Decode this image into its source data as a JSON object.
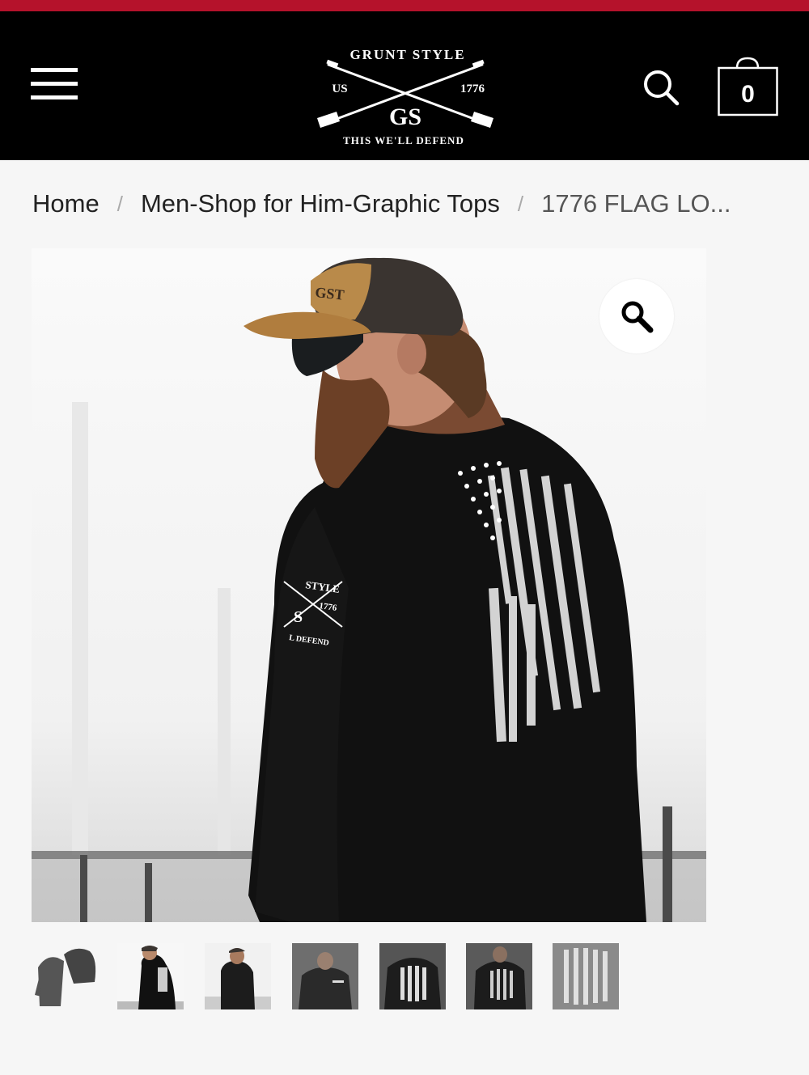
{
  "header": {
    "brand_top": "GRUNT STYLE",
    "brand_left": "US",
    "brand_right": "1776",
    "brand_monogram": "GS",
    "brand_tagline": "THIS WE'LL DEFEND",
    "menu_icon": "hamburger-menu-icon",
    "search_icon": "search-icon",
    "cart_icon": "shopping-bag-icon",
    "cart_count": "0"
  },
  "breadcrumb": {
    "items": [
      "Home",
      "Men-Shop for Him-Graphic Tops",
      "1776 FLAG LO..."
    ],
    "separator": "/"
  },
  "gallery": {
    "zoom_icon": "magnifier-zoom-icon",
    "thumbnail_count": 7,
    "sleeve_print": {
      "top": "STYLE",
      "mid": "1776",
      "monogram": "S",
      "tagline": "L DEFEND"
    },
    "cap_patch": "GST"
  },
  "colors": {
    "accent_stripe": "#b5122b",
    "header_bg": "#000000",
    "page_bg": "#f6f6f6",
    "breadcrumb_text": "#222222",
    "breadcrumb_separator": "#aaaaaa"
  }
}
